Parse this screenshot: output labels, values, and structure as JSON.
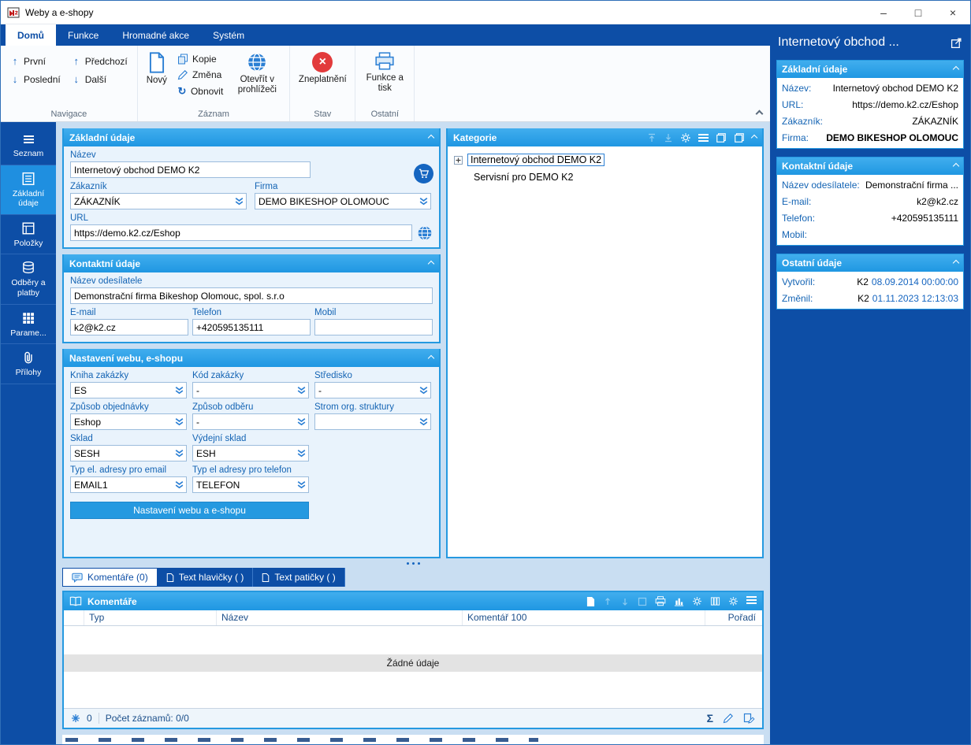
{
  "window": {
    "title": "Weby a e-shopy"
  },
  "icons": {
    "minimize": "–",
    "maximize": "□",
    "close": "×",
    "arrow_up": "↑",
    "arrow_down": "↓",
    "refresh": "↻",
    "cross": "×",
    "sum": "Σ"
  },
  "ribbon": {
    "tabs": [
      {
        "label": "Domů"
      },
      {
        "label": "Funkce"
      },
      {
        "label": "Hromadné akce"
      },
      {
        "label": "Systém"
      }
    ],
    "groups": {
      "navigace": {
        "label": "Navigace",
        "prvni": "První",
        "posledni": "Poslední",
        "predchozi": "Předchozí",
        "dalsi": "Další"
      },
      "zaznam": {
        "label": "Záznam",
        "novy": "Nový",
        "kopie": "Kopie",
        "zmena": "Změna",
        "obnovit": "Obnovit",
        "otevrit": "Otevřít v prohlížeči"
      },
      "stav": {
        "label": "Stav",
        "zneplatneni": "Zneplatnění"
      },
      "ostatni": {
        "label": "Ostatní",
        "funkce_a_tisk": "Funkce a tisk"
      }
    }
  },
  "sidebar": {
    "items": [
      {
        "label": "Seznam"
      },
      {
        "label": "Základní údaje"
      },
      {
        "label": "Položky"
      },
      {
        "label": "Odběry a platby"
      },
      {
        "label": "Parame..."
      },
      {
        "label": "Přílohy"
      }
    ]
  },
  "basic_panel": {
    "title": "Základní údaje",
    "nazev": {
      "label": "Název",
      "value": "Internetový obchod DEMO K2"
    },
    "zakaznik": {
      "label": "Zákazník",
      "value": "ZÁKAZNÍK"
    },
    "firma": {
      "label": "Firma",
      "value": "DEMO BIKESHOP OLOMOUC"
    },
    "url": {
      "label": "URL",
      "value": "https://demo.k2.cz/Eshop"
    }
  },
  "contact_panel": {
    "title": "Kontaktní údaje",
    "odesilatel": {
      "label": "Název odesílatele",
      "value": "Demonstrační firma Bikeshop Olomouc, spol. s.r.o"
    },
    "email": {
      "label": "E-mail",
      "value": "k2@k2.cz"
    },
    "telefon": {
      "label": "Telefon",
      "value": "+420595135111"
    },
    "mobil": {
      "label": "Mobil",
      "value": ""
    }
  },
  "settings_panel": {
    "title": "Nastavení webu, e-shopu",
    "kniha_zakazky": {
      "label": "Kniha zakázky",
      "value": "ES"
    },
    "kod_zakazky": {
      "label": "Kód zakázky",
      "value": "-"
    },
    "stredisko": {
      "label": "Středisko",
      "value": "-"
    },
    "zpusob_objednavky": {
      "label": "Způsob objednávky",
      "value": "Eshop"
    },
    "zpusob_odberu": {
      "label": "Způsob odběru",
      "value": "-"
    },
    "strom": {
      "label": "Strom org. struktury",
      "value": ""
    },
    "sklad": {
      "label": "Sklad",
      "value": "SESH"
    },
    "vydejni_sklad": {
      "label": "Výdejní sklad",
      "value": "ESH"
    },
    "typ_email": {
      "label": "Typ el. adresy pro email",
      "value": "EMAIL1"
    },
    "typ_telefon": {
      "label": "Typ el adresy pro telefon",
      "value": "TELEFON"
    },
    "button": "Nastavení webu a e-shopu"
  },
  "categories_panel": {
    "title": "Kategorie",
    "items": [
      {
        "label": "Internetový obchod DEMO K2"
      },
      {
        "label": "Servisní pro DEMO K2"
      }
    ]
  },
  "bottom_tabs": [
    {
      "label": "Komentáře (0)"
    },
    {
      "label": "Text hlavičky ( )"
    },
    {
      "label": "Text patičky ( )"
    }
  ],
  "comments_panel": {
    "title": "Komentáře",
    "columns": [
      "Typ",
      "Název",
      "Komentář 100",
      "Pořadí"
    ],
    "empty_text": "Žádné údaje",
    "frozen_count": "0",
    "records_label": "Počet záznamů: 0/0"
  },
  "preview": {
    "title": "Internetový obchod ...",
    "basic": {
      "title": "Základní údaje",
      "rows": [
        {
          "label": "Název:",
          "value": "Internetový obchod DEMO K2"
        },
        {
          "label": "URL:",
          "value": "https://demo.k2.cz/Eshop"
        },
        {
          "label": "Zákazník:",
          "value": "ZÁKAZNÍK"
        },
        {
          "label": "Firma:",
          "value": "DEMO BIKESHOP OLOMOUC"
        }
      ]
    },
    "contact": {
      "title": "Kontaktní údaje",
      "rows": [
        {
          "label": "Název odesílatele:",
          "value": "Demonstrační firma ..."
        },
        {
          "label": "E-mail:",
          "value": "k2@k2.cz"
        },
        {
          "label": "Telefon:",
          "value": "+420595135111"
        },
        {
          "label": "Mobil:",
          "value": ""
        }
      ]
    },
    "other": {
      "title": "Ostatní údaje",
      "rows": [
        {
          "label": "Vytvořil:",
          "user": "K2",
          "date": "08.09.2014 00:00:00"
        },
        {
          "label": "Změnil:",
          "user": "K2",
          "date": "01.11.2023 12:13:03"
        }
      ]
    }
  }
}
